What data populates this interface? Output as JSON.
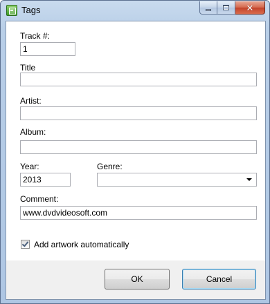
{
  "window": {
    "title": "Tags",
    "minimize_icon": "minimize-icon",
    "maximize_icon": "maximize-icon",
    "close_icon": "close-icon",
    "close_glyph": "✕"
  },
  "form": {
    "track_label": "Track #:",
    "track_value": "1",
    "title_label": "Title",
    "title_value": "",
    "artist_label": "Artist:",
    "artist_value": "",
    "album_label": "Album:",
    "album_value": "",
    "year_label": "Year:",
    "year_value": "2013",
    "genre_label": "Genre:",
    "genre_value": "",
    "comment_label": "Comment:",
    "comment_value": "www.dvdvideosoft.com",
    "artwork_label": "Add artwork automatically",
    "artwork_checked": true
  },
  "buttons": {
    "ok_label": "OK",
    "cancel_label": "Cancel"
  },
  "colors": {
    "titlebar": "#b9cfe8",
    "close_button": "#c2432a",
    "default_button_border": "#3c7fb1"
  }
}
